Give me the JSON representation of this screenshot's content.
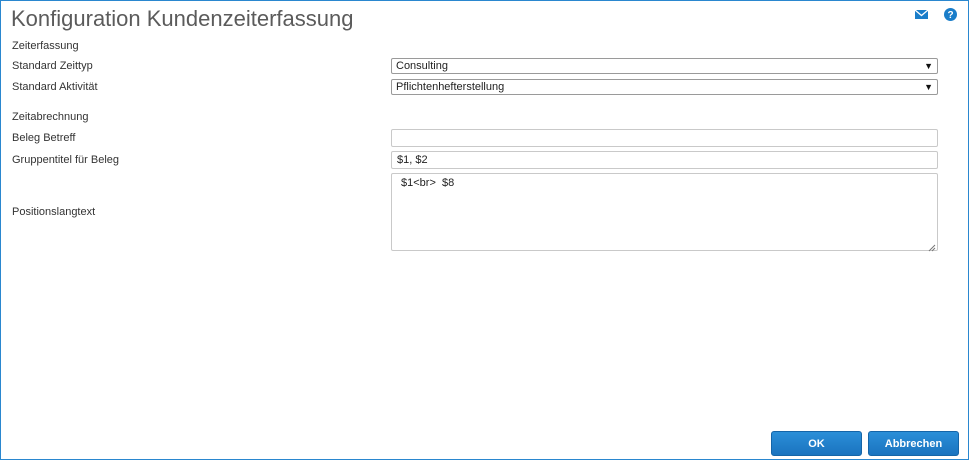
{
  "dialog": {
    "title": "Konfiguration Kundenzeiterfassung",
    "icons": {
      "mail": "mail-icon",
      "help": "help-icon"
    }
  },
  "zeiterfassung": {
    "section_label": "Zeiterfassung",
    "zeittyp": {
      "label": "Standard Zeittyp",
      "value": "Consulting"
    },
    "aktivitaet": {
      "label": "Standard Aktivität",
      "value": "Pflichtenhefterstellung"
    }
  },
  "zeitabrechnung": {
    "section_label": "Zeitabrechnung",
    "beleg_betreff": {
      "label": "Beleg Betreff",
      "value": ""
    },
    "gruppentitel": {
      "label": "Gruppentitel für Beleg",
      "value": "$1, $2"
    },
    "positionslangtext": {
      "label": "Positionslangtext",
      "value": "$1<br>  $8"
    }
  },
  "footer": {
    "ok_label": "OK",
    "cancel_label": "Abbrechen"
  },
  "colors": {
    "accent": "#1a7dc9",
    "border": "#2a87cf",
    "title": "#5b5b5b"
  }
}
